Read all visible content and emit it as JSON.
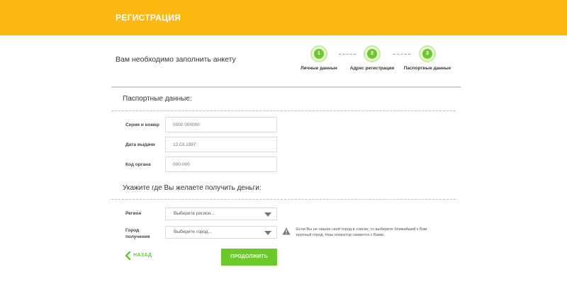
{
  "header": {
    "title": "РЕГИСТРАЦИЯ",
    "bg_color": "#fdb813"
  },
  "intro": {
    "text": "Вам необходимо заполнить анкету"
  },
  "stepper": {
    "steps": [
      {
        "number": "1",
        "label": "Личные данные"
      },
      {
        "number": "2",
        "label": "Адрес регистрации"
      },
      {
        "number": "3",
        "label": "Паспортные данные"
      }
    ],
    "accent_color": "#6dc82b"
  },
  "passport": {
    "title": "Паспортные данные:",
    "series_label": "Серия и номер",
    "series_placeholder": "0000 000000",
    "date_label": "Дата выдачи",
    "date_placeholder": "12.03.1997",
    "code_label": "Код органа",
    "code_placeholder": "000-000"
  },
  "money": {
    "title": "Укажите где Вы желаете получить деньги:",
    "region_label": "Регион",
    "region_placeholder": "Выберите регион...",
    "city_label_1": "Город",
    "city_label_2": "получения",
    "city_placeholder": "Выберите город...",
    "warning_icon": "warning-icon",
    "warning_text": "Если Вы не нашли свой город в списке, то выберите ближайший к Вам крупный город. Наш оператор свяжется с Вами."
  },
  "actions": {
    "back_label": "НАЗАД",
    "continue_label": "ПРОДОЛЖИТЬ",
    "button_color": "#6dc82b"
  }
}
